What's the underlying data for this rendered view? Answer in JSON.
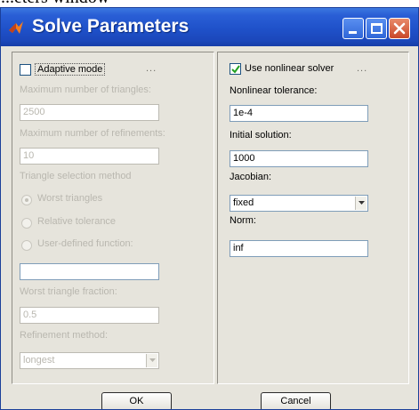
{
  "caption": "...eters window",
  "window": {
    "title": "Solve Parameters"
  },
  "left_panel": {
    "adaptive_mode": {
      "label": "Adaptive mode",
      "checked": false,
      "dots": "..."
    },
    "max_triangles": {
      "label": "Maximum number of triangles:",
      "value": "2500"
    },
    "max_refinements": {
      "label": "Maximum number of refinements:",
      "value": "10"
    },
    "triangle_selection": {
      "label": "Triangle selection method",
      "options": [
        "Worst triangles",
        "Relative tolerance",
        "User-defined function:"
      ],
      "selected": "Worst triangles",
      "function_value": ""
    },
    "worst_fraction": {
      "label": "Worst triangle fraction:",
      "value": "0.5"
    },
    "refinement_method": {
      "label": "Refinement method:",
      "value": "longest"
    }
  },
  "right_panel": {
    "use_nonlinear": {
      "label": "Use nonlinear solver",
      "checked": true,
      "dots": "..."
    },
    "nonlinear_tolerance": {
      "label": "Nonlinear tolerance:",
      "value": "1e-4"
    },
    "initial_solution": {
      "label": "Initial solution:",
      "value": "1000"
    },
    "jacobian": {
      "label": "Jacobian:",
      "value": "fixed"
    },
    "norm": {
      "label": "Norm:",
      "value": "inf"
    }
  },
  "buttons": {
    "ok": "OK",
    "cancel": "Cancel"
  },
  "colors": {
    "titlebar": "#1f51c9",
    "close_button": "#c9472a",
    "disabled_text": "#b9b7af",
    "dialog_background": "#e6e4dc"
  }
}
